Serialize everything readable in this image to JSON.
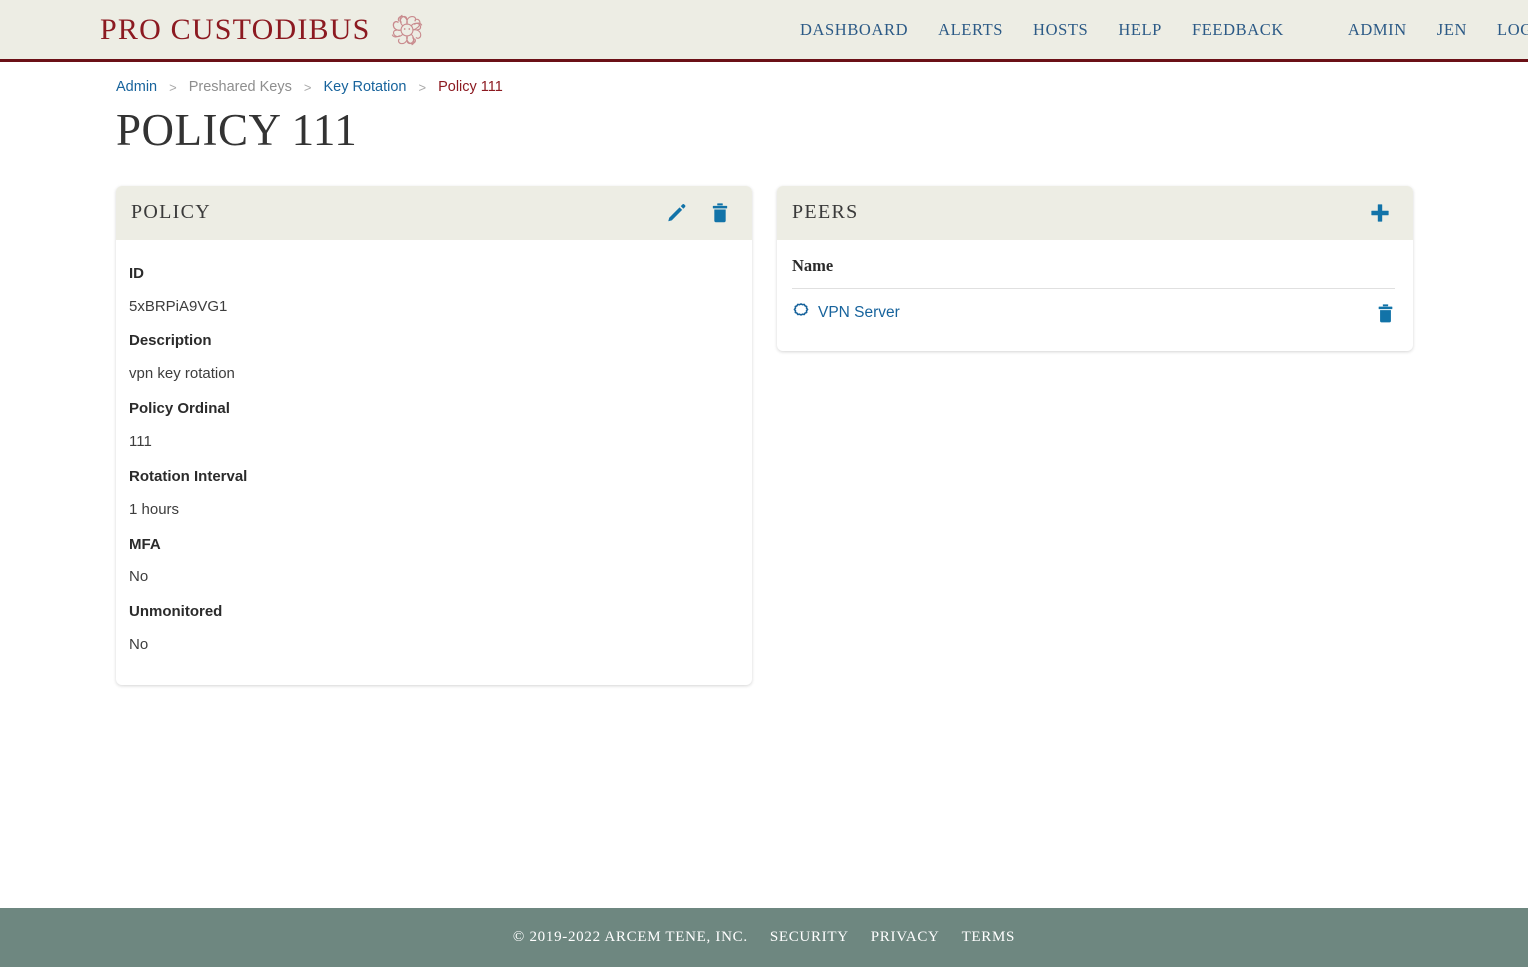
{
  "header": {
    "brand_name": "PRO CUSTODIBUS",
    "brand_emblem_icon": "medusa-head-emblem",
    "nav_primary": [
      {
        "label": "DASHBOARD"
      },
      {
        "label": "ALERTS"
      },
      {
        "label": "HOSTS"
      },
      {
        "label": "HELP"
      },
      {
        "label": "FEEDBACK"
      }
    ],
    "nav_account": [
      {
        "label": "ADMIN"
      },
      {
        "label": "JEN"
      },
      {
        "label": "LOG OUT"
      }
    ]
  },
  "breadcrumb": {
    "items": [
      {
        "label": "Admin",
        "type": "link"
      },
      {
        "label": "Preshared Keys",
        "type": "muted"
      },
      {
        "label": "Key Rotation",
        "type": "link"
      },
      {
        "label": "Policy 111",
        "type": "current"
      }
    ],
    "separator": ">"
  },
  "page": {
    "title": "POLICY 111"
  },
  "policy_card": {
    "title": "POLICY",
    "edit_icon": "pencil-icon",
    "delete_icon": "trash-icon",
    "fields": [
      {
        "label": "ID",
        "value": "5xBRPiA9VG1"
      },
      {
        "label": "Description",
        "value": "vpn key rotation"
      },
      {
        "label": "Policy Ordinal",
        "value": "111"
      },
      {
        "label": "Rotation Interval",
        "value": "1 hours"
      },
      {
        "label": "MFA",
        "value": "No"
      },
      {
        "label": "Unmonitored",
        "value": "No"
      }
    ]
  },
  "peers_card": {
    "title": "PEERS",
    "add_icon": "plus-icon",
    "columns": [
      "Name"
    ],
    "rows": [
      {
        "name": "VPN Server",
        "peer_icon": "cog-node-icon",
        "delete_icon": "trash-icon"
      }
    ]
  },
  "footer": {
    "copyright": "© 2019-2022 ARCEM TENE, INC.",
    "links": [
      {
        "label": "SECURITY"
      },
      {
        "label": "PRIVACY"
      },
      {
        "label": "TERMS"
      }
    ]
  },
  "colors": {
    "brand_red": "#8C1A21",
    "header_bg": "#EDEDE4",
    "header_rule": "#6B1016",
    "nav_blue": "#2C5A86",
    "link_blue": "#17639C",
    "action_blue": "#1273A8",
    "footer_bg": "#6E8780",
    "title_gray": "#333333"
  }
}
